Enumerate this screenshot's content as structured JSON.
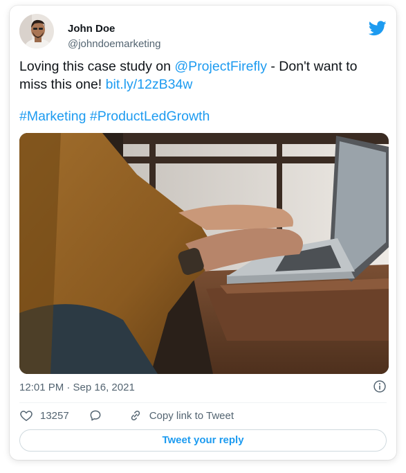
{
  "tweet": {
    "author_name": "John Doe",
    "author_handle": "@johndoemarketing",
    "text_before": "Loving this case study on ",
    "mention": "@ProjectFirefly",
    "text_middle": " - Don't want to miss this one! ",
    "short_link": "bit.ly/12zB34w",
    "hashtag_1": "#Marketing",
    "hashtag_2": "#ProductLedGrowth",
    "timestamp": "12:01 PM · Sep 16, 2021",
    "like_count": "13257",
    "copy_link_label": "Copy link to Tweet",
    "reply_button_label": "Tweet your reply"
  },
  "icons": {
    "brand": "twitter-bird-icon",
    "info": "info-icon",
    "like": "heart-icon",
    "reply": "reply-icon",
    "copy_link": "link-icon"
  },
  "colors": {
    "accent": "#1d9bf0",
    "muted_text": "#536471",
    "body_text": "#0f1419",
    "border": "#cfd9de"
  }
}
